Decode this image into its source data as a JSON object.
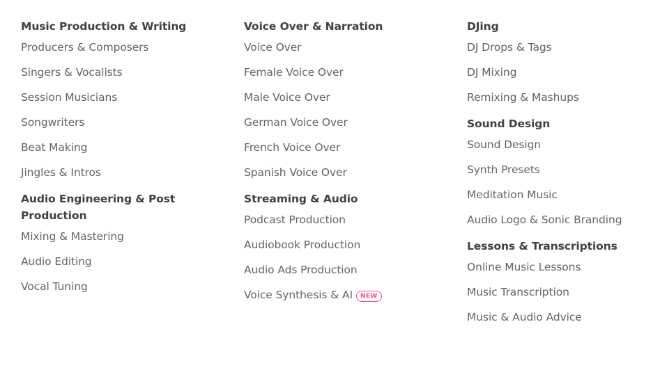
{
  "columns": [
    {
      "groups": [
        {
          "heading": "Music Production & Writing",
          "items": [
            "Producers & Composers",
            "Singers & Vocalists",
            "Session Musicians",
            "Songwriters",
            "Beat Making",
            "Jingles & Intros"
          ]
        },
        {
          "heading": "Audio Engineering & Post Production",
          "items": [
            "Mixing & Mastering",
            "Audio Editing",
            "Vocal Tuning"
          ]
        }
      ]
    },
    {
      "groups": [
        {
          "heading": "Voice Over & Narration",
          "items": [
            "Voice Over",
            "Female Voice Over",
            "Male Voice Over",
            "German Voice Over",
            "French Voice Over",
            "Spanish Voice Over"
          ]
        },
        {
          "heading": "Streaming & Audio",
          "items": [
            "Podcast Production",
            "Audiobook Production",
            "Audio Ads Production",
            "Voice Synthesis & AI"
          ],
          "badge": "NEW"
        }
      ]
    },
    {
      "groups": [
        {
          "heading": "DJing",
          "items": [
            "DJ Drops & Tags",
            "DJ Mixing",
            "Remixing & Mashups"
          ]
        },
        {
          "heading": "Sound Design",
          "items": [
            "Sound Design",
            "Synth Presets",
            "Meditation Music",
            "Audio Logo & Sonic Branding"
          ]
        },
        {
          "heading": "Lessons & Transcriptions",
          "items": [
            "Online Music Lessons",
            "Music Transcription",
            "Music & Audio Advice"
          ]
        }
      ]
    }
  ]
}
